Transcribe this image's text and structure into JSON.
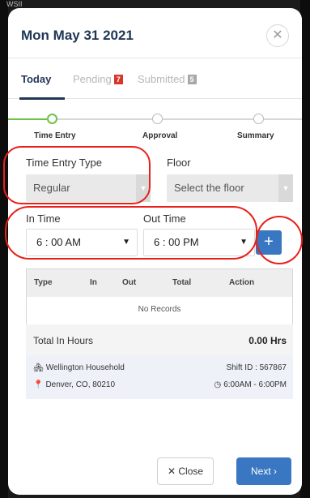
{
  "status_bar_text": "WSII",
  "header": {
    "title": "Mon May 31 2021",
    "close_icon": "close-icon"
  },
  "tabs": [
    {
      "label": "Today",
      "active": true
    },
    {
      "label": "Pending",
      "badge": "7",
      "badge_color": "#d9362b"
    },
    {
      "label": "Submitted",
      "badge": "5",
      "badge_color": "#a8a8a8"
    }
  ],
  "stepper": {
    "steps": [
      "Time Entry",
      "Approval",
      "Summary"
    ],
    "current_step": 1,
    "active_color": "#6ec24b"
  },
  "form": {
    "time_entry_type": {
      "label": "Time Entry Type",
      "value": "Regular"
    },
    "floor": {
      "label": "Floor",
      "placeholder": "Select the floor"
    },
    "in_time": {
      "label": "In Time",
      "value": "6 : 00 AM"
    },
    "out_time": {
      "label": "Out Time",
      "value": "6 : 00 PM"
    },
    "add_button": "+"
  },
  "table": {
    "columns": [
      "Type",
      "In",
      "Out",
      "Total",
      "Action"
    ],
    "empty_text": "No Records"
  },
  "totals": {
    "label": "Total In Hours",
    "value": "0.00 Hrs"
  },
  "shift": {
    "household": "Wellington Household",
    "location": "Denver, CO, 80210",
    "shift_id": "Shift ID : 567867",
    "hours": "6:00AM - 6:00PM"
  },
  "footer": {
    "close_label": "Close",
    "next_label": "Next"
  },
  "colors": {
    "primary": "#3a77c2",
    "title": "#1f3656",
    "annotation": "#e8201b"
  }
}
